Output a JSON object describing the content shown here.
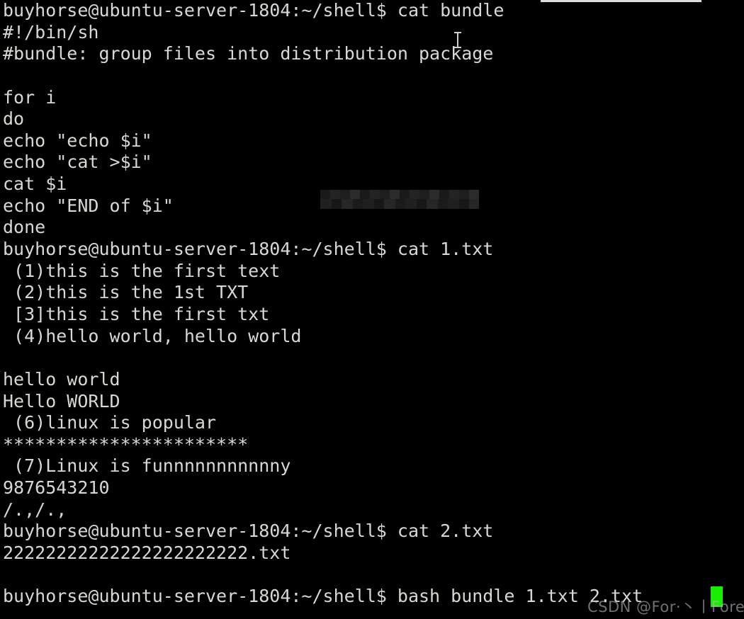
{
  "terminal": {
    "app": "terminal-window",
    "background_color": "#000000",
    "foreground_color": "#d8d8d3",
    "cursor_color": "#16f000",
    "prompt": "buyhorse@ubuntu-server-1804:~/shell$ ",
    "lines": [
      "buyhorse@ubuntu-server-1804:~/shell$ cat bundle",
      "#!/bin/sh",
      "#bundle: group files into distribution package",
      "",
      "for i",
      "do",
      "echo \"echo $i\"",
      "echo \"cat >$i\"",
      "cat $i",
      "echo \"END of $i\"",
      "done",
      "buyhorse@ubuntu-server-1804:~/shell$ cat 1.txt",
      " (1)this is the first text",
      " (2)this is the 1st TXT",
      " [3]this is the first txt",
      " (4)hello world, hello world",
      "",
      "hello world",
      "Hello WORLD",
      " (6)linux is popular",
      "***********************",
      " (7)Linux is funnnnnnnnnnny",
      "9876543210",
      "/.,/.,",
      "buyhorse@ubuntu-server-1804:~/shell$ cat 2.txt",
      "22222222222222222222222.txt",
      "",
      "buyhorse@ubuntu-server-1804:~/shell$ bash bundle 1.txt 2.txt"
    ]
  },
  "watermark": {
    "text": "CSDN @For·丶丨Forever"
  },
  "overlays": {
    "mouse_cursor": "text-ibeam-cursor",
    "block_cursor": "block-cursor",
    "redaction": "redacted-blur-block",
    "top_rule": "top-scrollbar-rule"
  }
}
